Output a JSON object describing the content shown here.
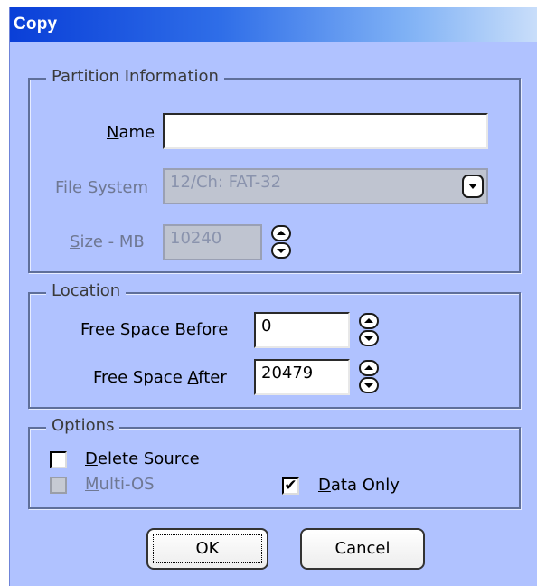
{
  "window": {
    "title": "Copy"
  },
  "partition_info": {
    "legend": "Partition Information",
    "name": {
      "label_pre": "",
      "label_key": "N",
      "label_post": "ame",
      "value": ""
    },
    "file_system": {
      "label_pre": "File ",
      "label_key": "S",
      "label_post": "ystem",
      "value": "12/Ch: FAT-32",
      "icon": "chevron-down-icon"
    },
    "size": {
      "label_pre": "",
      "label_key": "S",
      "label_post": "ize - MB",
      "value": "10240",
      "icon": "spin-updown-icon"
    }
  },
  "location": {
    "legend": "Location",
    "free_before": {
      "label_pre": "Free Space ",
      "label_key": "B",
      "label_post": "efore",
      "value": "0"
    },
    "free_after": {
      "label_pre": "Free Space ",
      "label_key": "A",
      "label_post": "fter",
      "value": "20479"
    }
  },
  "options": {
    "legend": "Options",
    "delete_source": {
      "label_pre": "",
      "label_key": "D",
      "label_post": "elete Source",
      "checked": false
    },
    "multi_os": {
      "label_pre": "",
      "label_key": "M",
      "label_post": "ulti-OS",
      "checked": false,
      "disabled": true
    },
    "data_only": {
      "label_pre": "",
      "label_key": "D",
      "label_post": "ata Only",
      "checked": true,
      "check_mark": "✔"
    }
  },
  "buttons": {
    "ok": "OK",
    "cancel": "Cancel"
  },
  "colors": {
    "dialog_bg": "#b0c2ff",
    "title_start": "#0a3fd8",
    "title_end": "#c9defa"
  }
}
